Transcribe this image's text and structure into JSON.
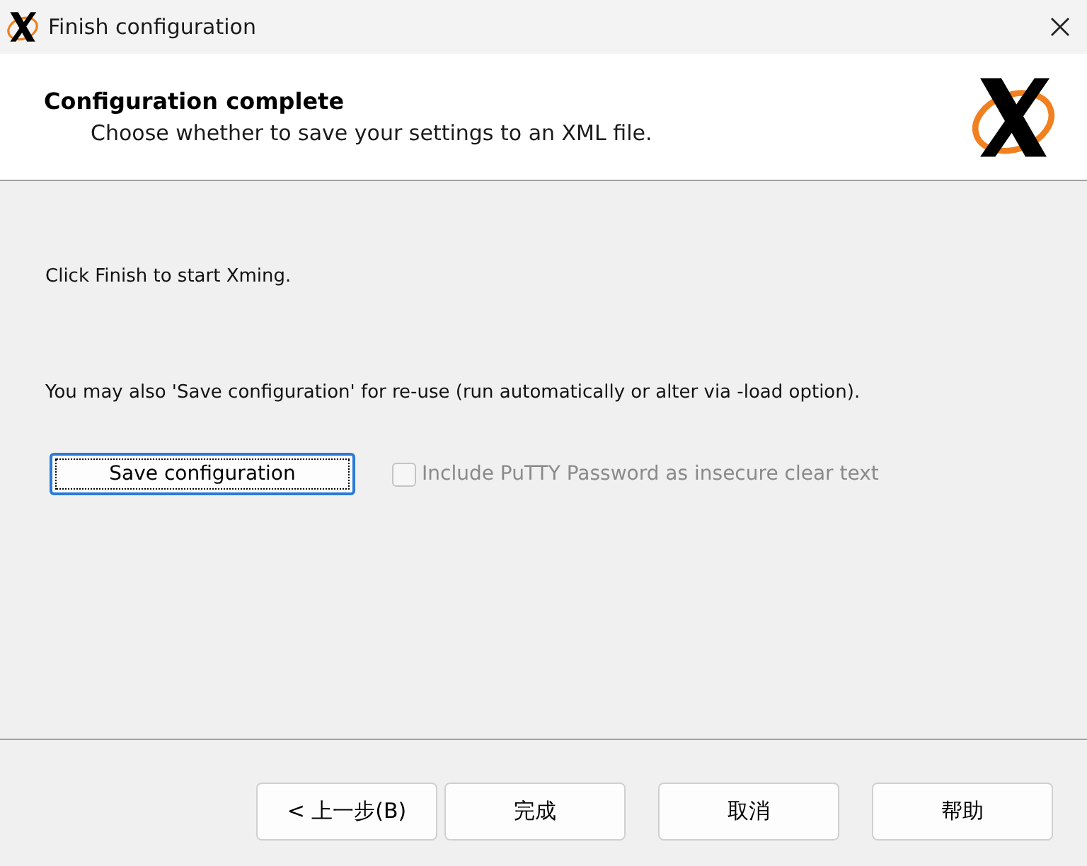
{
  "window": {
    "title": "Finish configuration"
  },
  "header": {
    "title": "Configuration complete",
    "subtitle": "Choose whether to save your settings to an XML file."
  },
  "body": {
    "paragraphs": [
      "Click Finish to start Xming.",
      "You may also 'Save configuration' for re-use (run automatically or alter via -load option)."
    ],
    "save_button": {
      "label": "Save configuration"
    },
    "checkbox": {
      "label": "Include PuTTY Password as insecure clear text",
      "checked": false,
      "disabled": true
    }
  },
  "buttons": [
    {
      "label": "< 上一步(B)"
    },
    {
      "label": "完成"
    },
    {
      "label": "取消"
    },
    {
      "label": "帮助"
    }
  ]
}
